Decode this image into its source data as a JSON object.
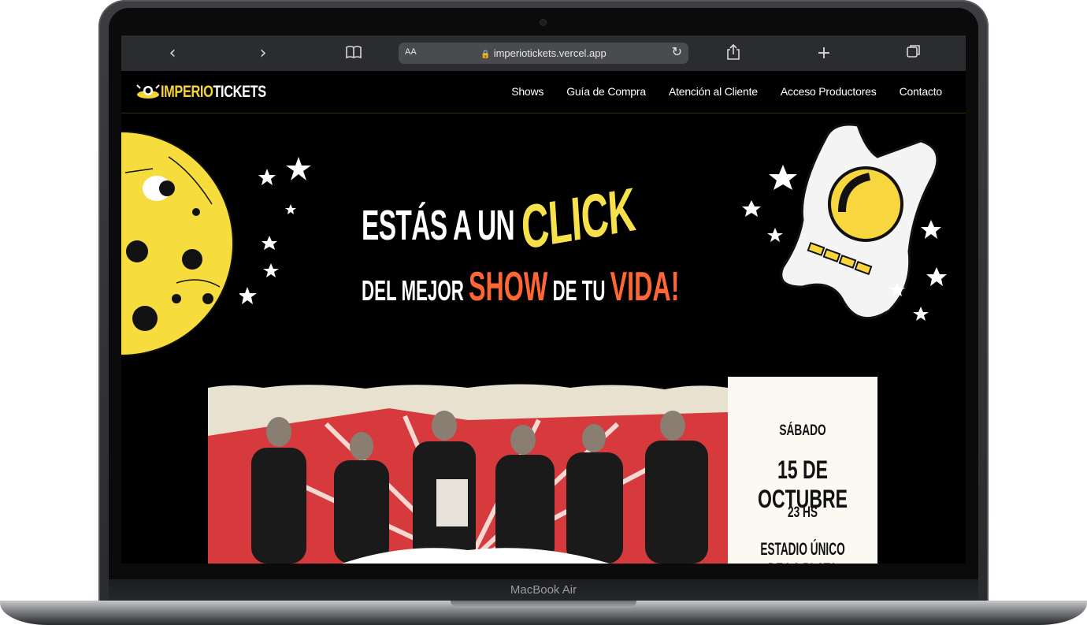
{
  "browser": {
    "aa_label": "AA",
    "url": "imperiotickets.vercel.app"
  },
  "site": {
    "logo_part1": "IMPERIO",
    "logo_part2": "TICKETS",
    "nav": [
      "Shows",
      "Guía de Compra",
      "Atención al Cliente",
      "Acceso Productores",
      "Contacto"
    ]
  },
  "hero": {
    "line1_prefix": "ESTÁS A UN ",
    "line1_highlight": "CLICK",
    "line2_a": "DEL MEJOR ",
    "line2_b": "SHOW",
    "line2_c": " DE TU ",
    "line2_d": "VIDA!"
  },
  "event": {
    "day": "SÁBADO",
    "date": "15 DE OCTUBRE",
    "time": "23 HS",
    "venue": "ESTADIO ÚNICO DE LA PLATA"
  },
  "device": {
    "label": "MacBook Air"
  },
  "colors": {
    "accent_yellow": "#f6e14a",
    "accent_orange": "#ff6633",
    "background": "#000000"
  }
}
